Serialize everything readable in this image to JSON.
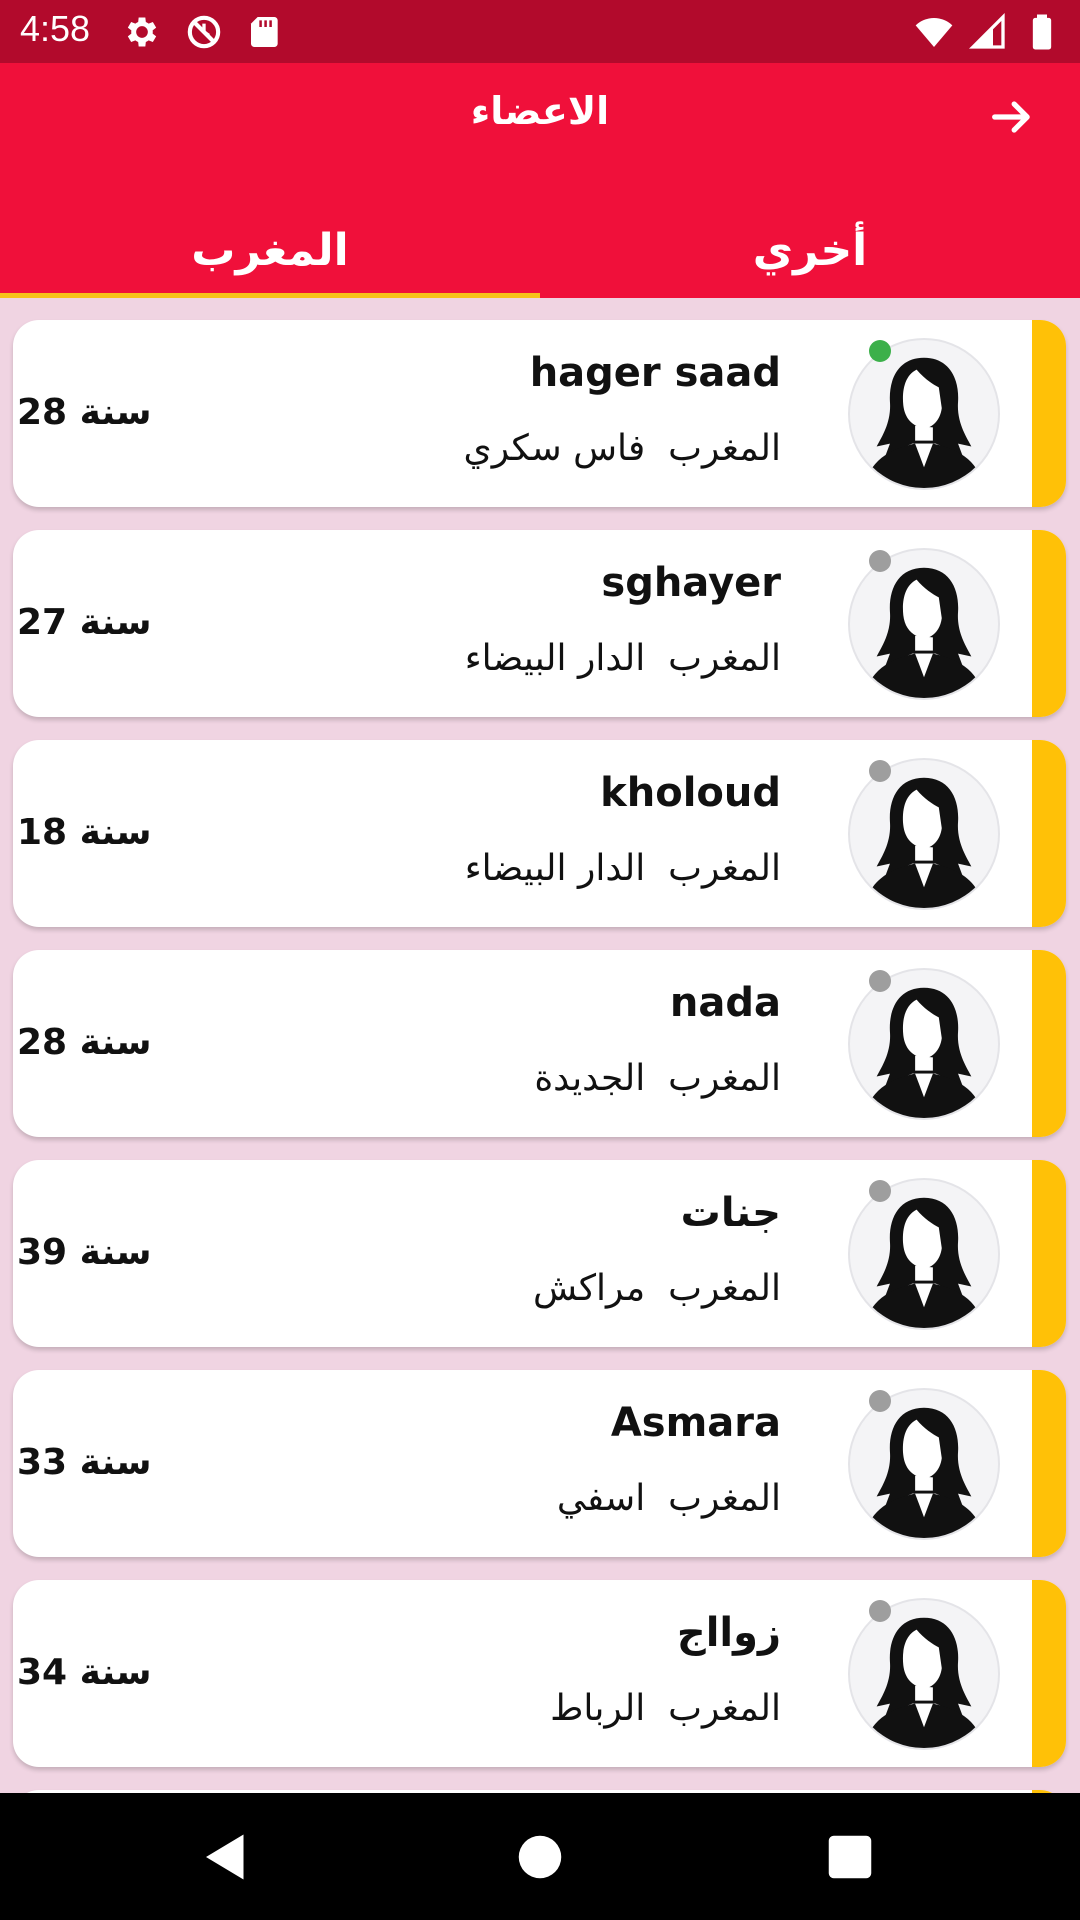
{
  "status_bar": {
    "time": "4:58"
  },
  "header": {
    "title": "الاعضاء"
  },
  "tabs": [
    {
      "label": "المغرب",
      "active": true
    },
    {
      "label": "أخري",
      "active": false
    }
  ],
  "members": [
    {
      "name": "hager saad",
      "country": "المغرب",
      "city": "فاس سكري",
      "age": "28 سنة",
      "online": true
    },
    {
      "name": "sghayer",
      "country": "المغرب",
      "city": "الدار البيضاء",
      "age": "27 سنة",
      "online": false
    },
    {
      "name": "kholoud",
      "country": "المغرب",
      "city": "الدار البيضاء",
      "age": "18 سنة",
      "online": false
    },
    {
      "name": "nada",
      "country": "المغرب",
      "city": "الجديدة",
      "age": "28 سنة",
      "online": false
    },
    {
      "name": "جنات",
      "country": "المغرب",
      "city": "مراكش",
      "age": "39 سنة",
      "online": false
    },
    {
      "name": "Asmara",
      "country": "المغرب",
      "city": "اسفي",
      "age": "33 سنة",
      "online": false
    },
    {
      "name": "زوااج",
      "country": "المغرب",
      "city": "الرباط",
      "age": "34 سنة",
      "online": false
    }
  ],
  "colors": {
    "status_bar": "#b20a2c",
    "app_bar": "#f0103a",
    "accent": "#ffc107",
    "background": "#f0d4e2",
    "online": "#3cb04a",
    "offline": "#9e9e9e"
  },
  "icons": {
    "status_left": [
      "settings-icon",
      "sync-off-icon",
      "sd-card-icon"
    ],
    "status_right": [
      "wifi-icon",
      "signal-icon",
      "battery-icon"
    ],
    "back": "arrow-right-icon",
    "nav": [
      "back-triangle-icon",
      "home-circle-icon",
      "recents-square-icon"
    ]
  }
}
